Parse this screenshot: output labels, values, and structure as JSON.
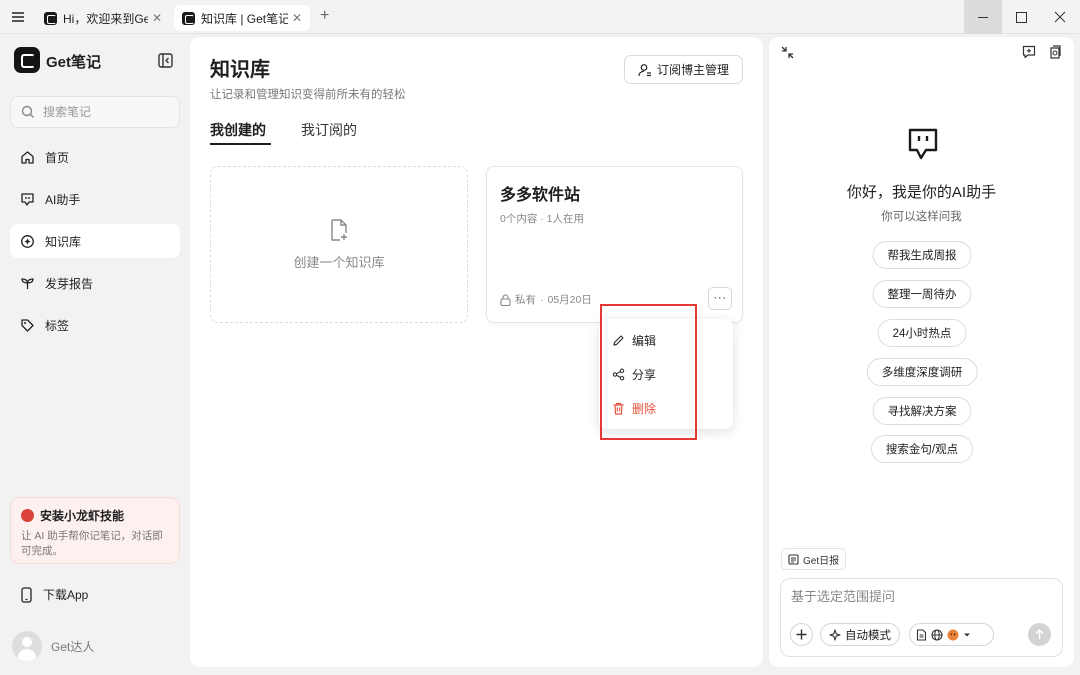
{
  "window": {
    "tabs": [
      {
        "label": "Hi，欢迎来到Get笔记",
        "active": false
      },
      {
        "label": "知识库 | Get笔记",
        "active": true
      }
    ],
    "new_tab": "+"
  },
  "sidebar": {
    "brand": "Get笔记",
    "search_placeholder": "搜索笔记",
    "items": [
      {
        "label": "首页",
        "icon": "home-icon"
      },
      {
        "label": "AI助手",
        "icon": "ai-chat-icon"
      },
      {
        "label": "知识库",
        "icon": "knowledge-base-icon",
        "active": true
      },
      {
        "label": "发芽报告",
        "icon": "sprout-icon"
      },
      {
        "label": "标签",
        "icon": "tag-icon"
      }
    ],
    "promo": {
      "title": "安装小龙虾技能",
      "desc": "让 AI 助手帮你记笔记，对话即可完成。"
    },
    "download": "下载App",
    "user": "Get达人"
  },
  "main": {
    "title": "知识库",
    "subtitle": "让记录和管理知识变得前所未有的轻松",
    "subscribe_button": "订阅博主管理",
    "tabs": [
      "我创建的",
      "我订阅的"
    ],
    "active_tab": 0,
    "create_card_label": "创建一个知识库",
    "kb_card": {
      "title": "多多软件站",
      "meta": "0个内容 · 1人在用",
      "privacy": "私有",
      "date": "05月20日",
      "more": "···"
    },
    "context_menu": [
      {
        "label": "编辑",
        "icon": "edit-icon"
      },
      {
        "label": "分享",
        "icon": "share-icon"
      },
      {
        "label": "删除",
        "icon": "trash-icon",
        "color": "#e5533d"
      }
    ]
  },
  "ai_panel": {
    "greeting": "你好，我是你的AI助手",
    "hint": "你可以这样问我",
    "suggestions": [
      "帮我生成周报",
      "整理一周待办",
      "24小时热点",
      "多维度深度调研",
      "寻找解决方案",
      "搜索金句/观点"
    ],
    "daily_chip": "Get日报",
    "input_placeholder": "基于选定范围提问",
    "mode_label": "自动模式"
  },
  "colors": {
    "accent_dark": "#141414",
    "danger": "#e5533d",
    "highlight_box": "#e53935",
    "promo_bg": "#fdf1f0"
  }
}
